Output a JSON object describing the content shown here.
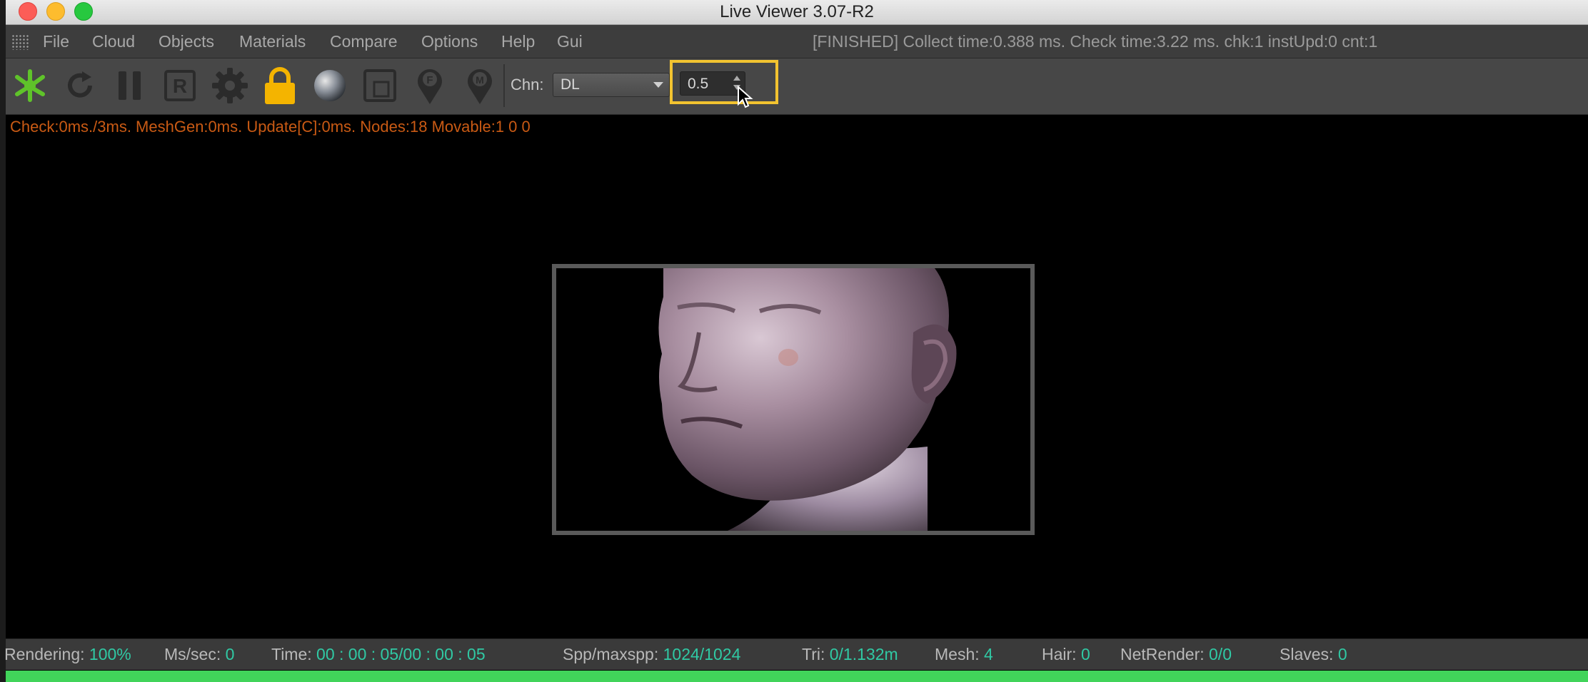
{
  "window": {
    "title": "Live Viewer 3.07-R2"
  },
  "menu": {
    "items": [
      "File",
      "Cloud",
      "Objects",
      "Materials",
      "Compare",
      "Options",
      "Help",
      "Gui"
    ],
    "status": "[FINISHED] Collect time:0.388 ms.  Check time:3.22 ms.  chk:1  instUpd:0  cnt:1"
  },
  "toolbar": {
    "icons": [
      "octane-render-icon",
      "restart-icon",
      "pause-icon",
      "region-render-icon",
      "settings-gear-icon",
      "lock-icon",
      "material-sphere-icon",
      "focus-region-icon",
      "focus-picker-icon",
      "material-picker-icon"
    ],
    "channel_label": "Chn:",
    "channel_value": "DL",
    "spin_value": "0.5"
  },
  "viewport": {
    "info_line": "Check:0ms./3ms. MeshGen:0ms. Update[C]:0ms. Nodes:18 Movable:1  0 0"
  },
  "statusbar": {
    "rendering_label": "Rendering:",
    "rendering_value": "100%",
    "mssec_label": "Ms/sec:",
    "mssec_value": "0",
    "time_label": "Time:",
    "time_value": "00 : 00 : 05/00 : 00 : 05",
    "spp_label": "Spp/maxspp:",
    "spp_value": "1024/1024",
    "tri_label": "Tri:",
    "tri_value": "0/1.132m",
    "mesh_label": "Mesh:",
    "mesh_value": "4",
    "hair_label": "Hair:",
    "hair_value": "0",
    "netrender_label": "NetRender:",
    "netrender_value": "0/0",
    "slaves_label": "Slaves:",
    "slaves_value": "0"
  },
  "progress": {
    "fraction": 1.0
  },
  "colors": {
    "accent_green": "#41d45a",
    "value_teal": "#30c9a4",
    "info_orange": "#c95a14",
    "highlight_yellow": "#f2c330"
  }
}
